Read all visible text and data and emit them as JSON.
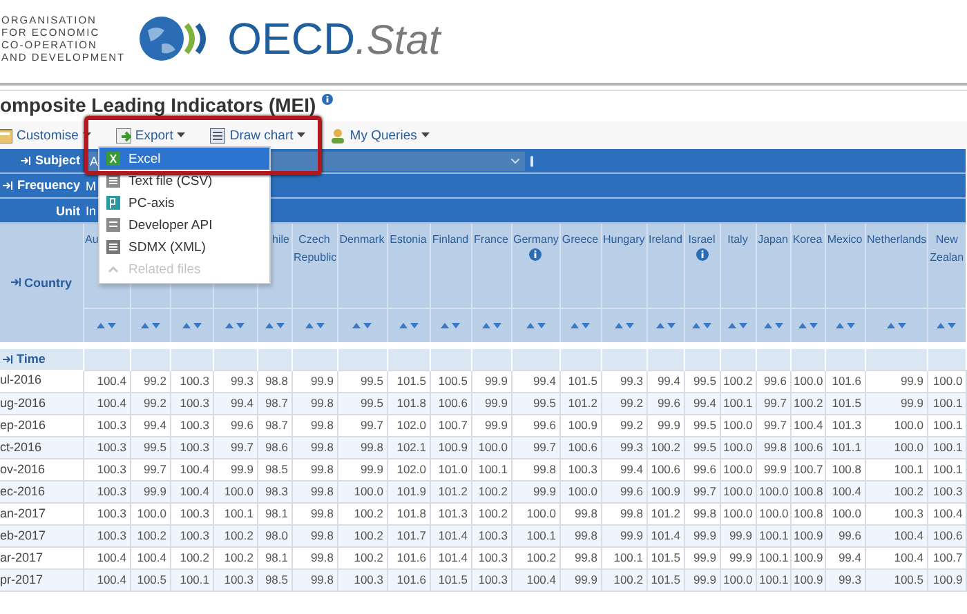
{
  "org_name": [
    "ORGANISATION",
    "FOR ECONOMIC",
    "CO-OPERATION",
    "AND DEVELOPMENT"
  ],
  "brand": {
    "main": "OECD",
    "suffix": ".Stat"
  },
  "title": "omposite Leading Indicators (MEI)",
  "toolbar": [
    {
      "label": "Customise"
    },
    {
      "label": "Export"
    },
    {
      "label": "Draw chart"
    },
    {
      "label": "My Queries"
    }
  ],
  "export_menu": [
    {
      "label": "Excel",
      "selected": true,
      "disabled": false
    },
    {
      "label": "Text file (CSV)",
      "selected": false,
      "disabled": false
    },
    {
      "label": "PC-axis",
      "selected": false,
      "disabled": false
    },
    {
      "label": "Developer API",
      "selected": false,
      "disabled": false
    },
    {
      "label": "SDMX (XML)",
      "selected": false,
      "disabled": false
    },
    {
      "label": "Related files",
      "selected": false,
      "disabled": true
    }
  ],
  "filters": [
    {
      "label": "Subject",
      "value": "A",
      "kind": "select"
    },
    {
      "label": "Frequency",
      "value": "M",
      "kind": "text"
    },
    {
      "label": "Unit",
      "value": "In",
      "kind": "text"
    }
  ],
  "country_label": "Country",
  "time_label": "Time",
  "columns": [
    {
      "name": "Au"
    },
    {},
    {},
    {},
    {
      "name": "hile"
    },
    {
      "name": "Czech Republic"
    },
    {
      "name": "Denmark"
    },
    {
      "name": "Estonia"
    },
    {
      "name": "Finland"
    },
    {
      "name": "France"
    },
    {
      "name": "Germany",
      "info": true
    },
    {
      "name": "Greece"
    },
    {
      "name": "Hungary"
    },
    {
      "name": "Ireland"
    },
    {
      "name": "Israel",
      "info": true
    },
    {
      "name": "Italy"
    },
    {
      "name": "Japan"
    },
    {
      "name": "Korea"
    },
    {
      "name": "Mexico"
    },
    {
      "name": "Netherlands"
    },
    {
      "name": "New Zealan"
    }
  ],
  "rows": [
    {
      "time": "ul-2016",
      "values": [
        "100.4",
        "99.2",
        "100.3",
        "99.3",
        "98.8",
        "99.9",
        "99.5",
        "101.5",
        "100.5",
        "99.9",
        "99.4",
        "101.5",
        "99.3",
        "99.4",
        "99.5",
        "100.2",
        "99.6",
        "100.0",
        "101.6",
        "99.9",
        "100.0"
      ]
    },
    {
      "time": "ug-2016",
      "values": [
        "100.4",
        "99.2",
        "100.3",
        "99.4",
        "98.7",
        "99.8",
        "99.5",
        "101.8",
        "100.6",
        "99.9",
        "99.5",
        "101.2",
        "99.2",
        "99.6",
        "99.4",
        "100.1",
        "99.7",
        "100.2",
        "101.5",
        "99.9",
        "100.1"
      ]
    },
    {
      "time": "ep-2016",
      "values": [
        "100.3",
        "99.4",
        "100.3",
        "99.6",
        "98.7",
        "99.8",
        "99.7",
        "102.0",
        "100.7",
        "99.9",
        "99.6",
        "100.9",
        "99.2",
        "99.9",
        "99.5",
        "100.0",
        "99.7",
        "100.4",
        "101.3",
        "100.0",
        "100.1"
      ]
    },
    {
      "time": "ct-2016",
      "values": [
        "100.3",
        "99.5",
        "100.3",
        "99.7",
        "98.6",
        "99.8",
        "99.8",
        "102.1",
        "100.9",
        "100.0",
        "99.7",
        "100.6",
        "99.3",
        "100.2",
        "99.5",
        "100.0",
        "99.8",
        "100.6",
        "101.1",
        "100.0",
        "100.1"
      ]
    },
    {
      "time": "ov-2016",
      "values": [
        "100.3",
        "99.7",
        "100.4",
        "99.9",
        "98.5",
        "99.8",
        "99.9",
        "102.0",
        "101.0",
        "100.1",
        "99.8",
        "100.3",
        "99.4",
        "100.6",
        "99.6",
        "100.0",
        "99.9",
        "100.7",
        "100.8",
        "100.1",
        "100.1"
      ]
    },
    {
      "time": "ec-2016",
      "values": [
        "100.3",
        "99.9",
        "100.4",
        "100.0",
        "98.3",
        "99.8",
        "100.0",
        "101.9",
        "101.2",
        "100.2",
        "99.9",
        "100.0",
        "99.6",
        "100.9",
        "99.7",
        "100.0",
        "100.0",
        "100.8",
        "100.4",
        "100.2",
        "100.3"
      ]
    },
    {
      "time": "an-2017",
      "values": [
        "100.3",
        "100.0",
        "100.3",
        "100.1",
        "98.1",
        "99.8",
        "100.2",
        "101.8",
        "101.3",
        "100.2",
        "100.0",
        "99.8",
        "99.8",
        "101.2",
        "99.8",
        "100.0",
        "100.0",
        "100.8",
        "100.0",
        "100.3",
        "100.4"
      ]
    },
    {
      "time": "eb-2017",
      "values": [
        "100.3",
        "100.2",
        "100.3",
        "100.2",
        "98.0",
        "99.8",
        "100.2",
        "101.7",
        "101.4",
        "100.3",
        "100.1",
        "99.8",
        "99.9",
        "101.4",
        "99.9",
        "99.9",
        "100.1",
        "100.9",
        "99.6",
        "100.4",
        "100.6"
      ]
    },
    {
      "time": "ar-2017",
      "values": [
        "100.4",
        "100.4",
        "100.2",
        "100.2",
        "98.1",
        "99.8",
        "100.2",
        "101.6",
        "101.4",
        "100.3",
        "100.2",
        "99.8",
        "100.1",
        "101.5",
        "99.9",
        "99.9",
        "100.1",
        "100.9",
        "99.4",
        "100.4",
        "100.7"
      ]
    },
    {
      "time": "pr-2017",
      "values": [
        "100.4",
        "100.5",
        "100.1",
        "100.3",
        "98.5",
        "99.8",
        "100.3",
        "101.6",
        "101.5",
        "100.3",
        "100.4",
        "99.9",
        "100.2",
        "101.5",
        "99.9",
        "100.0",
        "100.1",
        "100.9",
        "99.3",
        "100.5",
        "100.9"
      ]
    }
  ]
}
